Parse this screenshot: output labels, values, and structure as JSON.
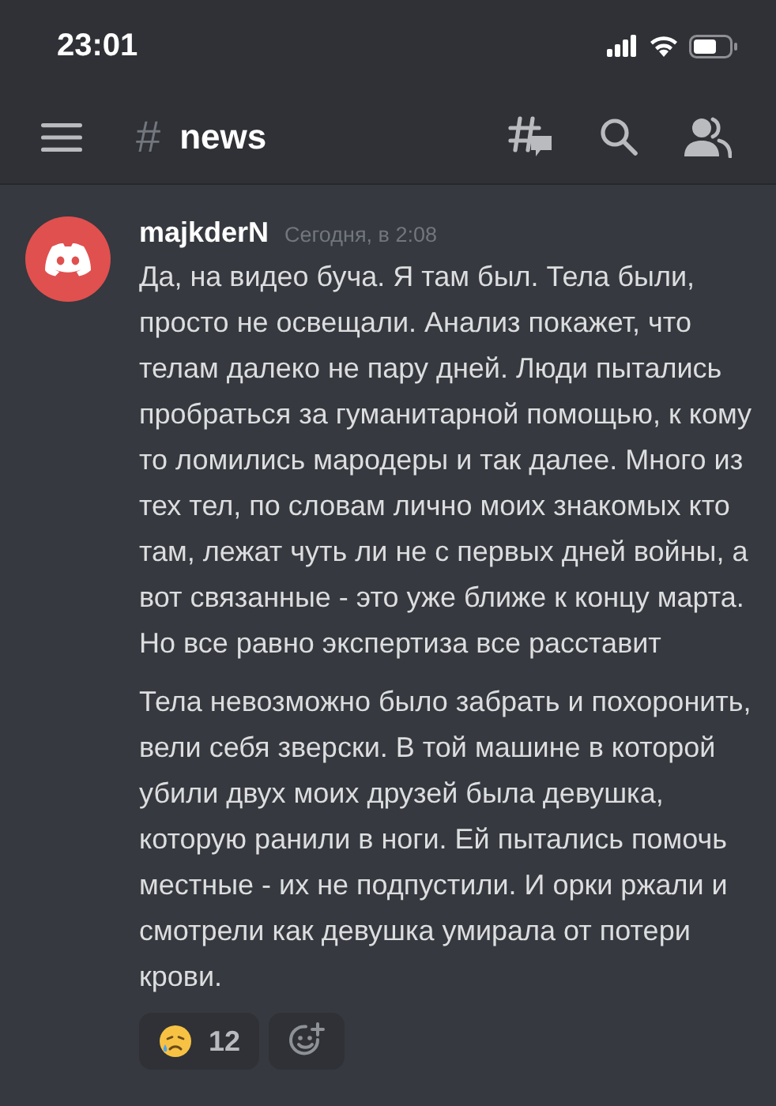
{
  "status_bar": {
    "time": "23:01"
  },
  "header": {
    "channel_hash": "#",
    "channel_name": "news"
  },
  "message": {
    "author": "majkderN",
    "timestamp": "Сегодня, в 2:08",
    "paragraphs": [
      "Да, на видео буча. Я там был. Тела были, просто не освещали. Анализ покажет, что телам далеко не пару дней. Люди пытались пробраться за гуманитарной помощью, к кому то ломились мародеры и так далее. Много из тех тел, по словам лично моих знакомых кто там, лежат чуть ли не с первых дней войны, а вот связанные - это уже ближе к концу марта. Но все равно экспертиза все расставит",
      "Тела невозможно было забрать и похоронить, вели себя зверски. В той машине в которой убили двух моих друзей была девушка, которую ранили в ноги. Ей пытались помочь местные - их не подпустили. И орки ржали и смотрели как девушка умирала от потери крови."
    ],
    "reactions": [
      {
        "kind": "emoji",
        "count": "12"
      },
      {
        "kind": "add"
      }
    ]
  }
}
